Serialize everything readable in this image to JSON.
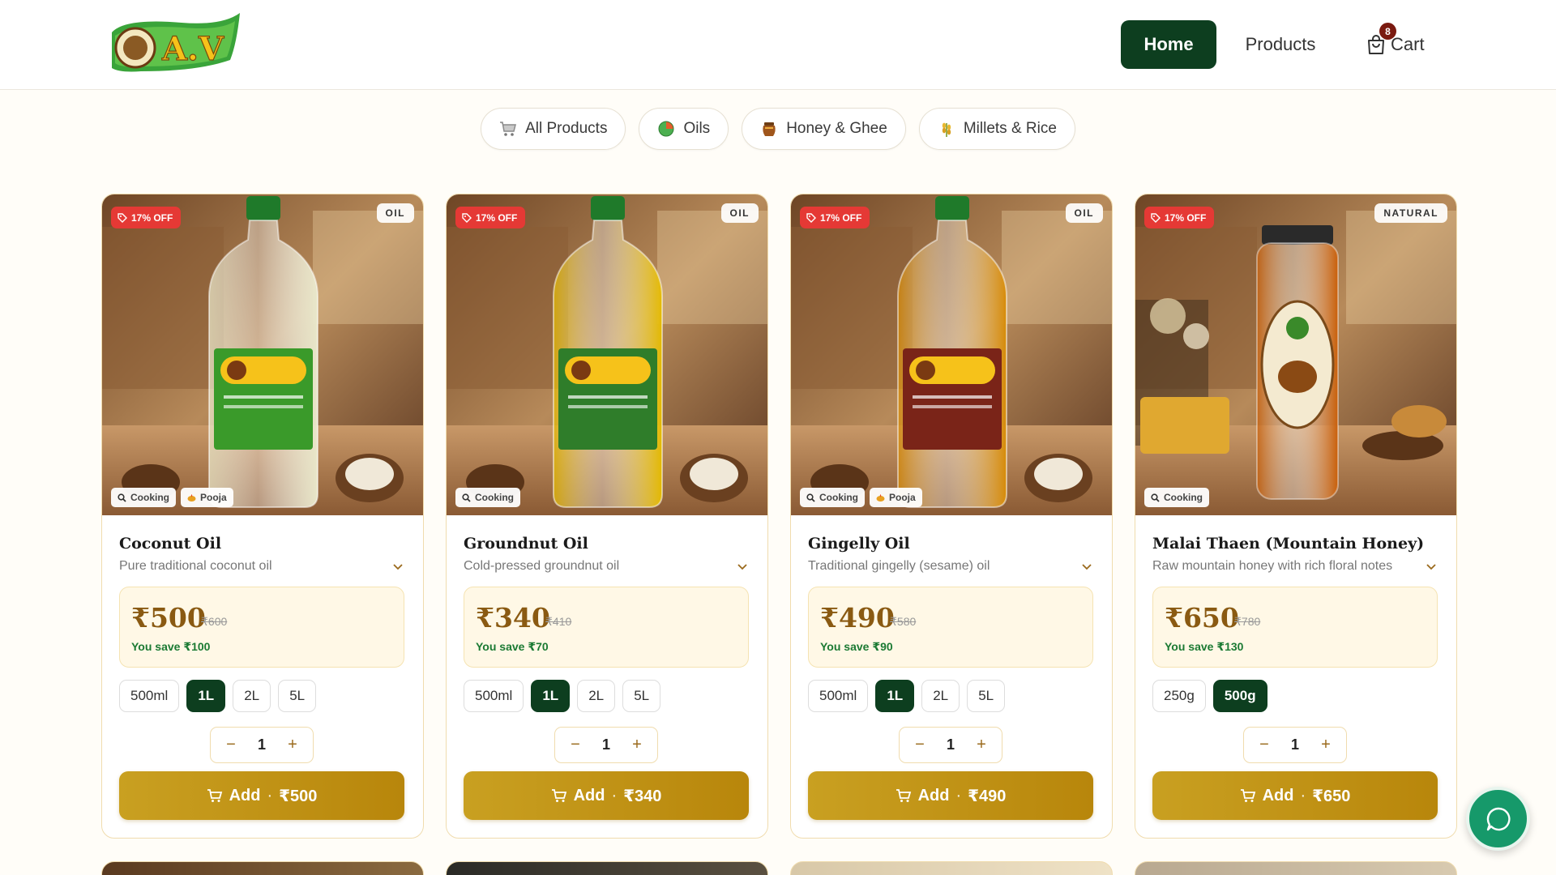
{
  "brand": {
    "logo_text": "A.V"
  },
  "nav": {
    "home": "Home",
    "products": "Products",
    "cart_label": "Cart",
    "cart_count": "8"
  },
  "categories": [
    {
      "label": "All Products",
      "icon": "cart-icon"
    },
    {
      "label": "Oils",
      "icon": "oil-drop-icon"
    },
    {
      "label": "Honey & Ghee",
      "icon": "honey-pot-icon"
    },
    {
      "label": "Millets & Rice",
      "icon": "grain-icon"
    }
  ],
  "products": [
    {
      "discount": "17% OFF",
      "category": "OIL",
      "tags": [
        "Cooking",
        "Pooja"
      ],
      "title": "Coconut Oil",
      "description": "Pure traditional coconut oil",
      "price": "₹500",
      "old_price": "₹600",
      "save": "You save ₹100",
      "sizes": [
        "500ml",
        "1L",
        "2L",
        "5L"
      ],
      "selected_size": "1L",
      "qty": "1",
      "add_label": "Add",
      "add_price": "₹500",
      "liquid_color": "#e8e6c8",
      "label_color": "#3a9a2a"
    },
    {
      "discount": "17% OFF",
      "category": "OIL",
      "tags": [
        "Cooking"
      ],
      "title": "Groundnut Oil",
      "description": "Cold-pressed groundnut oil",
      "price": "₹340",
      "old_price": "₹410",
      "save": "You save ₹70",
      "sizes": [
        "500ml",
        "1L",
        "2L",
        "5L"
      ],
      "selected_size": "1L",
      "qty": "1",
      "add_label": "Add",
      "add_price": "₹340",
      "liquid_color": "#e3b800",
      "label_color": "#2f7d2a"
    },
    {
      "discount": "17% OFF",
      "category": "OIL",
      "tags": [
        "Cooking",
        "Pooja"
      ],
      "title": "Gingelly Oil",
      "description": "Traditional gingelly (sesame) oil",
      "price": "₹490",
      "old_price": "₹580",
      "save": "You save ₹90",
      "sizes": [
        "500ml",
        "1L",
        "2L",
        "5L"
      ],
      "selected_size": "1L",
      "qty": "1",
      "add_label": "Add",
      "add_price": "₹490",
      "liquid_color": "#d68a06",
      "label_color": "#7a2418"
    },
    {
      "discount": "17% OFF",
      "category": "NATURAL",
      "tags": [
        "Cooking"
      ],
      "title": "Malai Thaen (Mountain Honey)",
      "description": "Raw mountain honey with rich floral notes",
      "price": "₹650",
      "old_price": "₹780",
      "save": "You save ₹130",
      "sizes": [
        "250g",
        "500g"
      ],
      "selected_size": "500g",
      "qty": "1",
      "add_label": "Add",
      "add_price": "₹650",
      "liquid_color": "#c85e08",
      "label_color": "#f4ead0"
    }
  ]
}
